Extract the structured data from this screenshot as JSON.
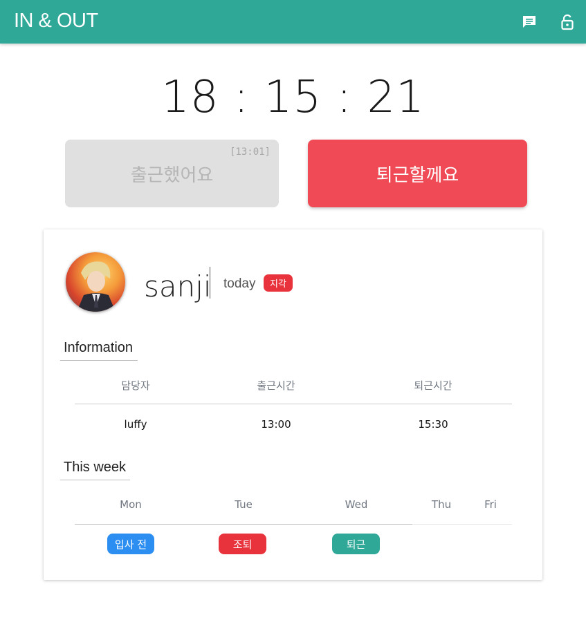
{
  "header": {
    "brand": "IN & OUT",
    "chat_icon": "chat-icon",
    "lock_icon": "lock-open-icon",
    "bg_color": "#2fa898"
  },
  "clock": {
    "time": "18 : 15 : 21"
  },
  "actions": {
    "checkin_label": "출근했어요",
    "checkin_time": "[13:01]",
    "checkout_label": "퇴근할께요"
  },
  "profile": {
    "username": "sanji",
    "today_label": "today",
    "status_badge": "지각"
  },
  "information": {
    "title": "Information",
    "headers": [
      "담당자",
      "출근시간",
      "퇴근시간"
    ],
    "row": [
      "luffy",
      "13:00",
      "15:30"
    ]
  },
  "week": {
    "title": "This week",
    "days": [
      "Mon",
      "Tue",
      "Wed",
      "Thu",
      "Fri"
    ],
    "statuses": [
      {
        "label": "입사 전",
        "color": "#2b8ef0"
      },
      {
        "label": "조퇴",
        "color": "#e8333c"
      },
      {
        "label": "퇴근",
        "color": "#2fa898"
      }
    ]
  }
}
